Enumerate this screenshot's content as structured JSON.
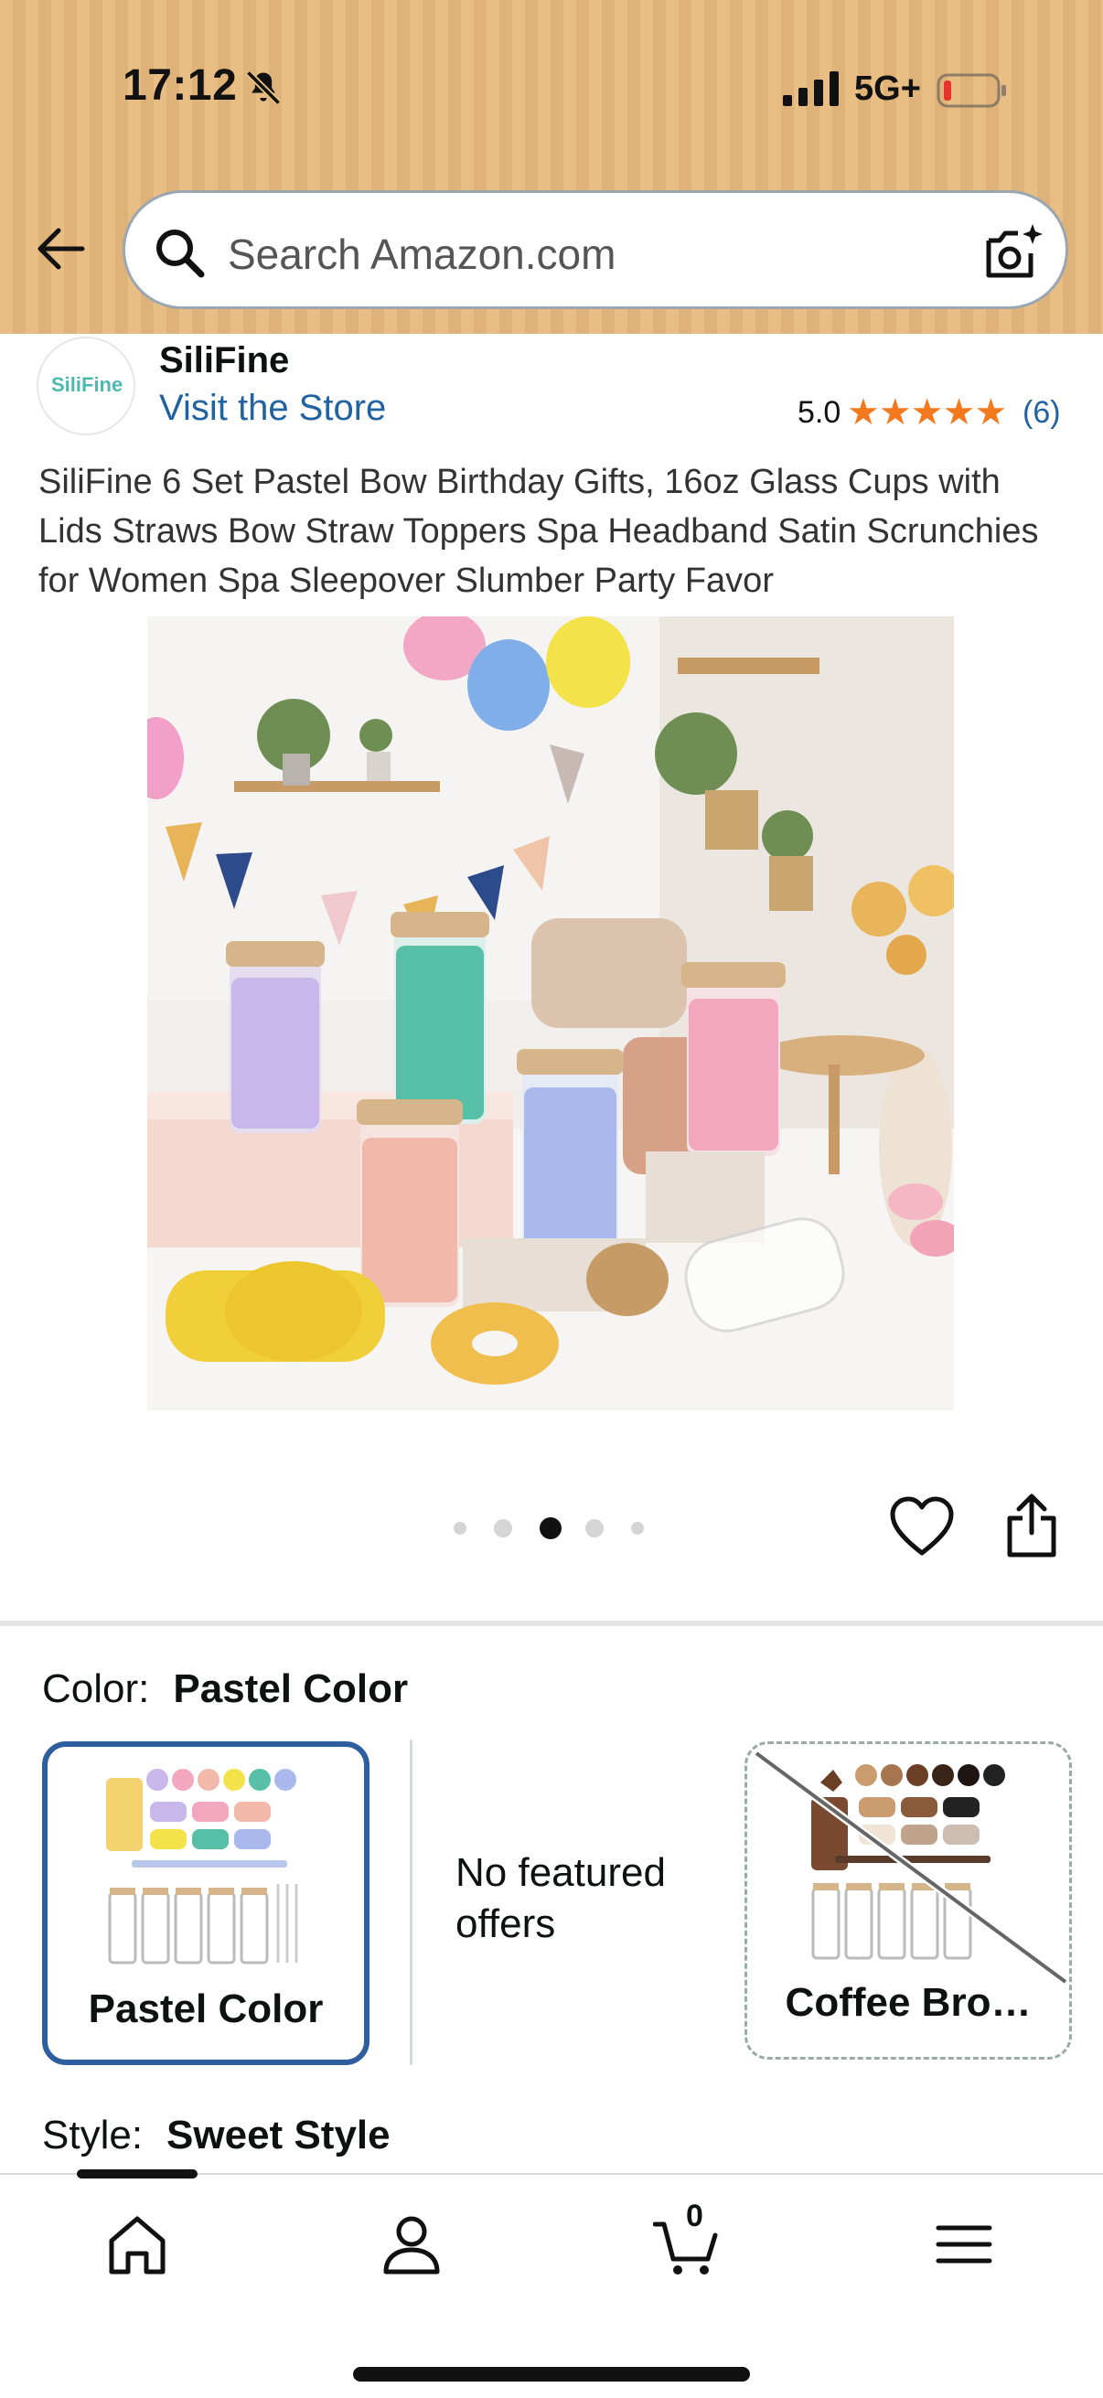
{
  "status_bar": {
    "time": "17:12",
    "network": "5G+"
  },
  "search": {
    "placeholder": "Search Amazon.com"
  },
  "brand": {
    "logo_text": "SiliFine",
    "name": "SiliFine",
    "visit_store": "Visit the Store"
  },
  "rating": {
    "value": "5.0",
    "stars": "★★★★★",
    "count": "(6)"
  },
  "product": {
    "title": "SiliFine 6 Set Pastel Bow Birthday Gifts, 16oz Glass Cups with Lids Straws Bow Straw Toppers Spa Headband Satin Scrunchies for Women Spa Sleepover Slumber Party Favor",
    "image_count": 5,
    "active_image_index": 2
  },
  "color": {
    "label": "Color:",
    "selected": "Pastel Color",
    "options": [
      {
        "label": "Pastel Color",
        "selected": true,
        "available": true
      },
      {
        "label": "Coffee Bro…",
        "selected": false,
        "available": false
      }
    ],
    "no_offers_text": "No featured offers"
  },
  "style": {
    "label": "Style:",
    "selected": "Sweet Style"
  },
  "bottom_nav": {
    "cart_count": "0",
    "items": [
      "home",
      "account",
      "cart",
      "menu"
    ],
    "active": "home"
  },
  "colors": {
    "header": "#E8BE85",
    "link": "#2162A1",
    "star": "#F3791F",
    "selected_border": "#2E5E9E"
  }
}
